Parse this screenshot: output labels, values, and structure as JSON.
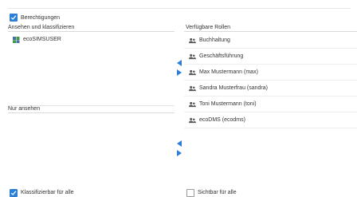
{
  "header": {
    "permissions_label": "Berechtigungen",
    "permissions_checked": true
  },
  "classify_section": {
    "label": "Ansehen und klassifizieren",
    "items": [
      {
        "label": "ecoSIMSUSER",
        "icon": "user-group-color-icon"
      }
    ]
  },
  "view_section": {
    "label": "Nur ansehen",
    "items": []
  },
  "available_roles": {
    "label": "Verfügbare Rollen",
    "items": [
      {
        "label": "Buchhaltung",
        "icon": "users-icon"
      },
      {
        "label": "Geschäftsführung",
        "icon": "users-icon"
      },
      {
        "label": "Max Mustermann (max)",
        "icon": "users-icon"
      },
      {
        "label": "Sandra Musterfrau (sandra)",
        "icon": "users-icon"
      },
      {
        "label": "Toni Mustermann (toni)",
        "icon": "users-icon"
      },
      {
        "label": "ecoDMS (ecodms)",
        "icon": "users-icon"
      }
    ]
  },
  "footer": {
    "classify_all_label": "Klassifizierbar für alle",
    "classify_all_checked": true,
    "visible_all_label": "Sichtbar für alle",
    "visible_all_checked": false
  },
  "colors": {
    "accent": "#2c7fd8",
    "row_border": "#efefef"
  }
}
